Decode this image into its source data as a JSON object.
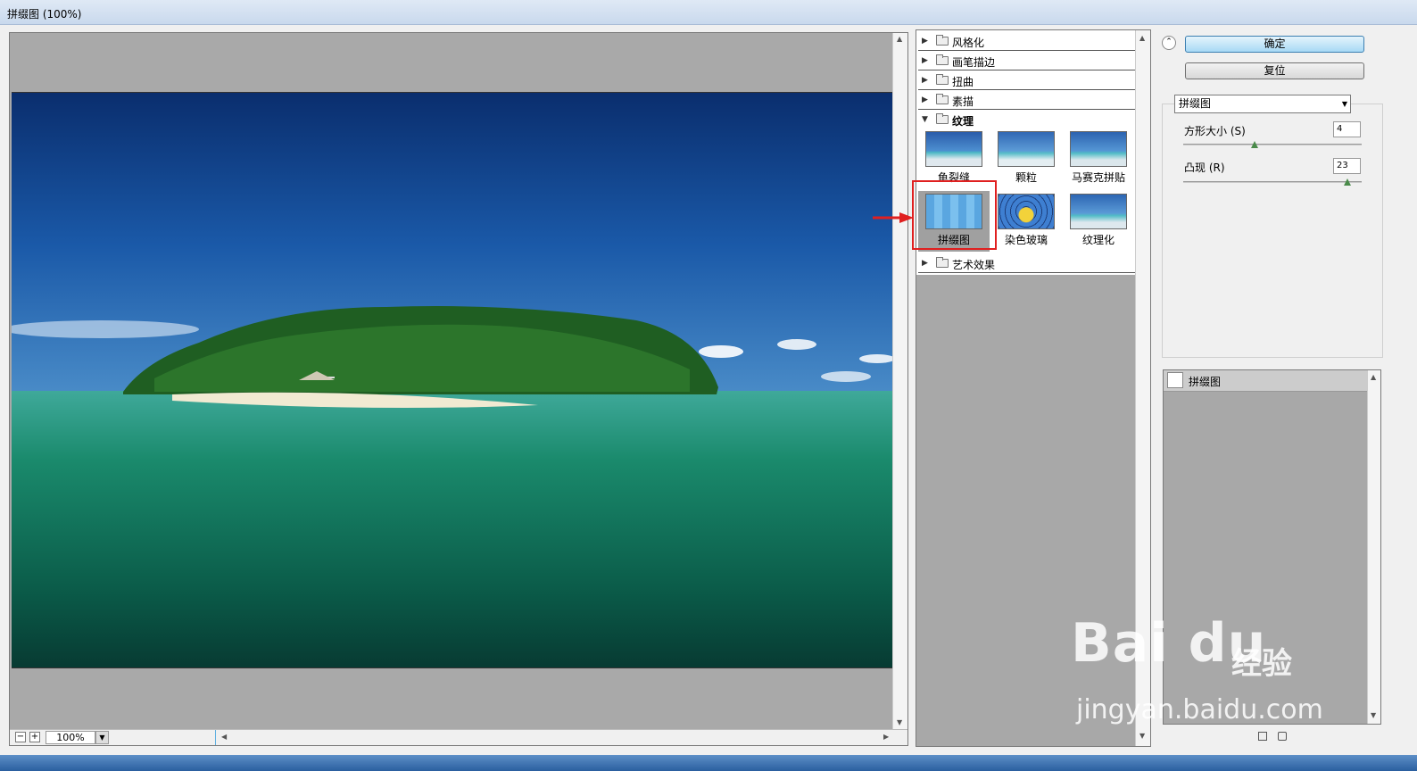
{
  "window": {
    "title": "拼缀图 (100%)"
  },
  "preview": {
    "zoom": "100%",
    "zoom_out": "−",
    "zoom_in": "+"
  },
  "gallery": {
    "categories": [
      {
        "label": "风格化",
        "open": false
      },
      {
        "label": "画笔描边",
        "open": false
      },
      {
        "label": "扭曲",
        "open": false
      },
      {
        "label": "素描",
        "open": false
      },
      {
        "label": "纹理",
        "open": true
      },
      {
        "label": "艺术效果",
        "open": false
      }
    ],
    "filters": [
      {
        "label": "龟裂缝",
        "icon": "craquelure-thumb"
      },
      {
        "label": "颗粒",
        "icon": "grain-thumb"
      },
      {
        "label": "马赛克拼贴",
        "icon": "mosaic-tiles-thumb"
      },
      {
        "label": "拼缀图",
        "icon": "patchwork-thumb",
        "selected": true
      },
      {
        "label": "染色玻璃",
        "icon": "stained-glass-thumb"
      },
      {
        "label": "纹理化",
        "icon": "texturizer-thumb"
      }
    ]
  },
  "buttons": {
    "ok": "确定",
    "reset": "复位"
  },
  "params": {
    "filter_select": "拼缀图",
    "square_size_label": "方形大小 (S)",
    "square_size_value": "4",
    "square_size_level": 0.4,
    "relief_label": "凸现 (R)",
    "relief_value": "23",
    "relief_level": 0.92
  },
  "layers": {
    "item": "拼缀图"
  },
  "watermark": {
    "logo": "Bai du",
    "cn": "经验",
    "url": "jingyan.baidu.com"
  },
  "colors": {
    "highlight": "#e02020",
    "ok_button": "#a7d9f5"
  }
}
